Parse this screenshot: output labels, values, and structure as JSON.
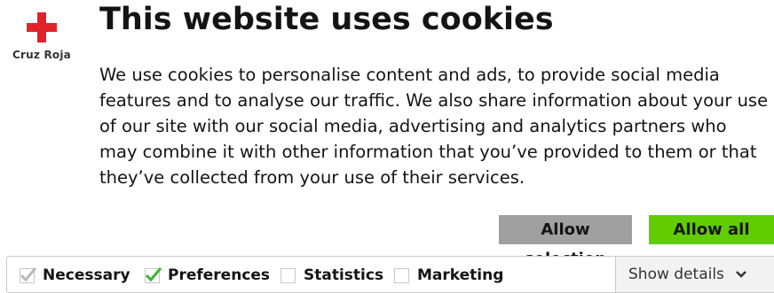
{
  "brand": {
    "name": "Cruz Roja",
    "accent": "#e1222b"
  },
  "dialog": {
    "title": "This website uses cookies",
    "body": "We use cookies to personalise content and ads, to provide social media features and to analyse our traffic. We also share information about your use of our site with our social media, advertising and analytics partners who may combine it with other information that you’ve provided to them or that they’ve collected from your use of their services."
  },
  "buttons": {
    "allow_selection": "Allow selection",
    "allow_all": "Allow all",
    "allow_all_color": "#61cc00",
    "allow_selection_color": "#a0a0a0"
  },
  "options": [
    {
      "label": "Necessary",
      "checked": true,
      "disabled": true
    },
    {
      "label": "Preferences",
      "checked": true,
      "disabled": false
    },
    {
      "label": "Statistics",
      "checked": false,
      "disabled": false
    },
    {
      "label": "Marketing",
      "checked": false,
      "disabled": false
    }
  ],
  "details": {
    "label": "Show details",
    "icon": "chevron-down-icon"
  }
}
